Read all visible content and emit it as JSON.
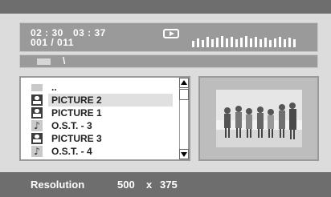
{
  "status": {
    "time_elapsed": "02 : 30",
    "time_total": "03 : 37",
    "track_counter": "001 / 011",
    "play_icon": "play-icon",
    "equalizer_icon": "equalizer-bars-icon"
  },
  "path": {
    "folder_icon": "folder-icon",
    "text": "\\"
  },
  "files": [
    {
      "label": "..",
      "icon": "folder-up-icon",
      "selected": false
    },
    {
      "label": "PICTURE 2",
      "icon": "picture-icon",
      "selected": true
    },
    {
      "label": "PICTURE 1",
      "icon": "picture-icon",
      "selected": false
    },
    {
      "label": "O.S.T. - 3",
      "icon": "music-note-icon",
      "selected": false
    },
    {
      "label": "PICTURE 3",
      "icon": "picture-icon",
      "selected": false
    },
    {
      "label": "O.S.T. - 4",
      "icon": "music-note-icon",
      "selected": false
    }
  ],
  "preview": {
    "icon": "photo-thumbnail"
  },
  "footer": {
    "resolution_label": "Resolution",
    "width": "500",
    "separator": "x",
    "height": "375"
  },
  "colors": {
    "panel_gray": "#9a9a9a",
    "bar_gray": "#6e6e6e",
    "background": "#dcdcdc",
    "selection": "#e0e0e0"
  }
}
